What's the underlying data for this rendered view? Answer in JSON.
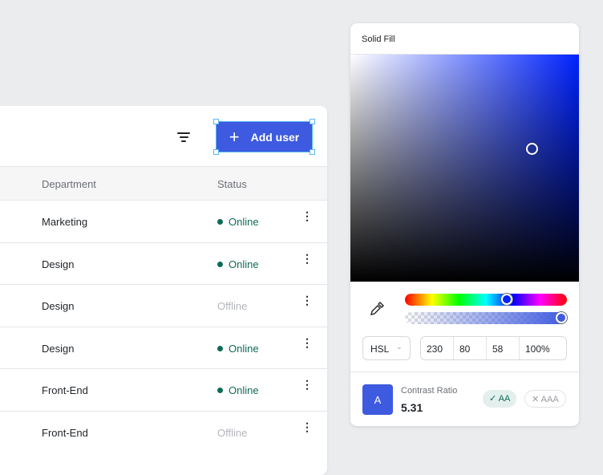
{
  "toolbar": {
    "filter_icon": "filter-icon",
    "add_user_label": "Add user"
  },
  "table": {
    "headers": {
      "department": "Department",
      "status": "Status"
    },
    "rows": [
      {
        "department": "Marketing",
        "status": "Online"
      },
      {
        "department": "Design",
        "status": "Online"
      },
      {
        "department": "Design",
        "status": "Offline"
      },
      {
        "department": "Design",
        "status": "Online"
      },
      {
        "department": "Front-End",
        "status": "Online"
      },
      {
        "department": "Front-End",
        "status": "Offline"
      }
    ]
  },
  "picker": {
    "title": "Solid Fill",
    "mode": "HSL",
    "h": "230",
    "s": "80",
    "l": "58",
    "alpha": "100%",
    "hue_fraction": 0.64,
    "alpha_fraction": 1.0,
    "swatch_letter": "A",
    "contrast_label": "Contrast Ratio",
    "contrast_value": "5.31",
    "aa": "AA",
    "aaa": "AAA",
    "color": "#3d5ae0"
  }
}
